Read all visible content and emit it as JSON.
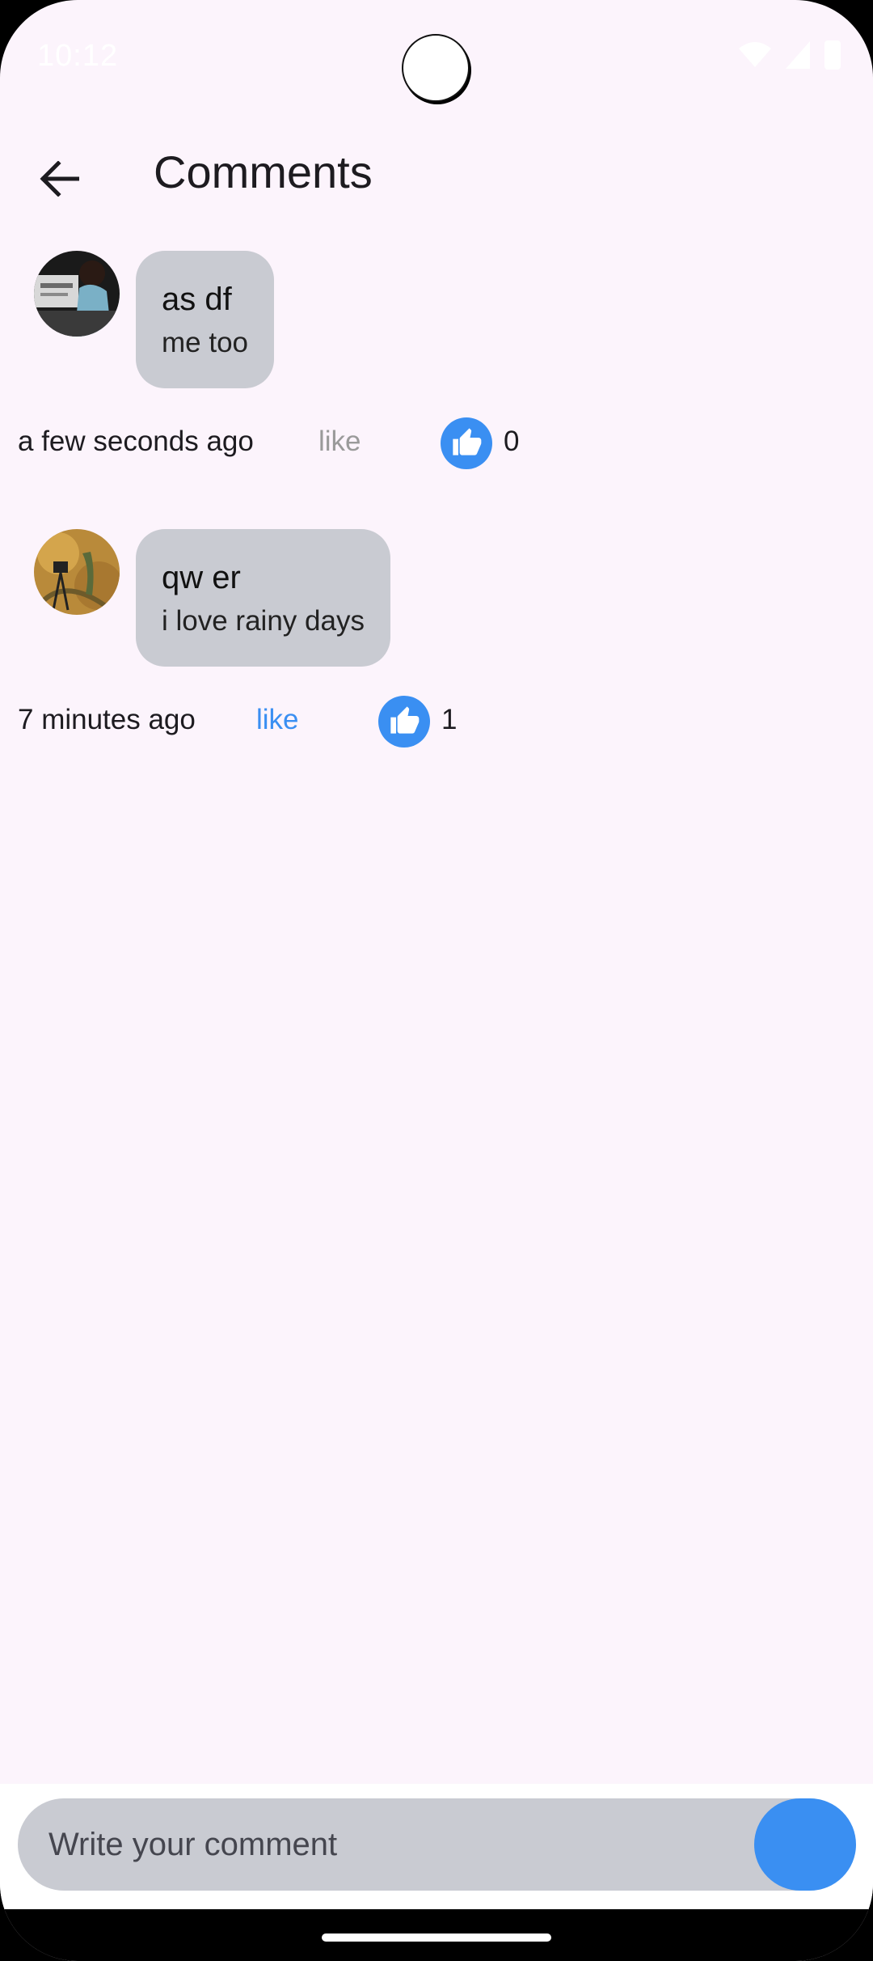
{
  "status_bar": {
    "time": "10:12"
  },
  "app_bar": {
    "title": "Comments",
    "back_icon": "arrow-back-icon"
  },
  "comments": [
    {
      "name": "as df",
      "text": "me too",
      "time": "a few seconds ago",
      "like_label": "like",
      "liked": false,
      "like_count": "0"
    },
    {
      "name": "qw er",
      "text": "i love rainy days",
      "time": "7 minutes ago",
      "like_label": "like",
      "liked": true,
      "like_count": "1"
    }
  ],
  "composer": {
    "placeholder": "Write your comment"
  },
  "colors": {
    "background": "#fcf4fc",
    "bubble": "#c9cbd2",
    "accent": "#3a8ff2",
    "like_inactive": "#9a9a9a"
  }
}
